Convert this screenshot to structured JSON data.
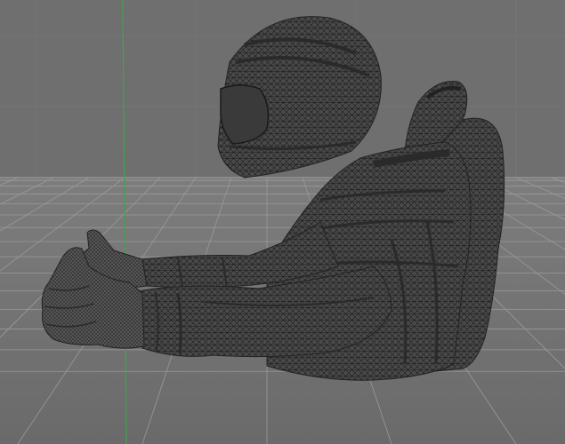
{
  "viewport": {
    "projection": "perspective",
    "background_color": "#6f6f6f",
    "horizon_color": "#8a8a8a",
    "grid": true,
    "grid_color": "#9a9a9a",
    "axis_y_color": "#3fa34d"
  },
  "model": {
    "display_mode": "wireframe-on-shaded",
    "parts": [
      "helmet",
      "seat",
      "torso",
      "left-arm",
      "right-arm",
      "left-hand",
      "right-hand"
    ],
    "mesh_color": "#4a4a4a",
    "wire_color": "#1a1a1a"
  }
}
